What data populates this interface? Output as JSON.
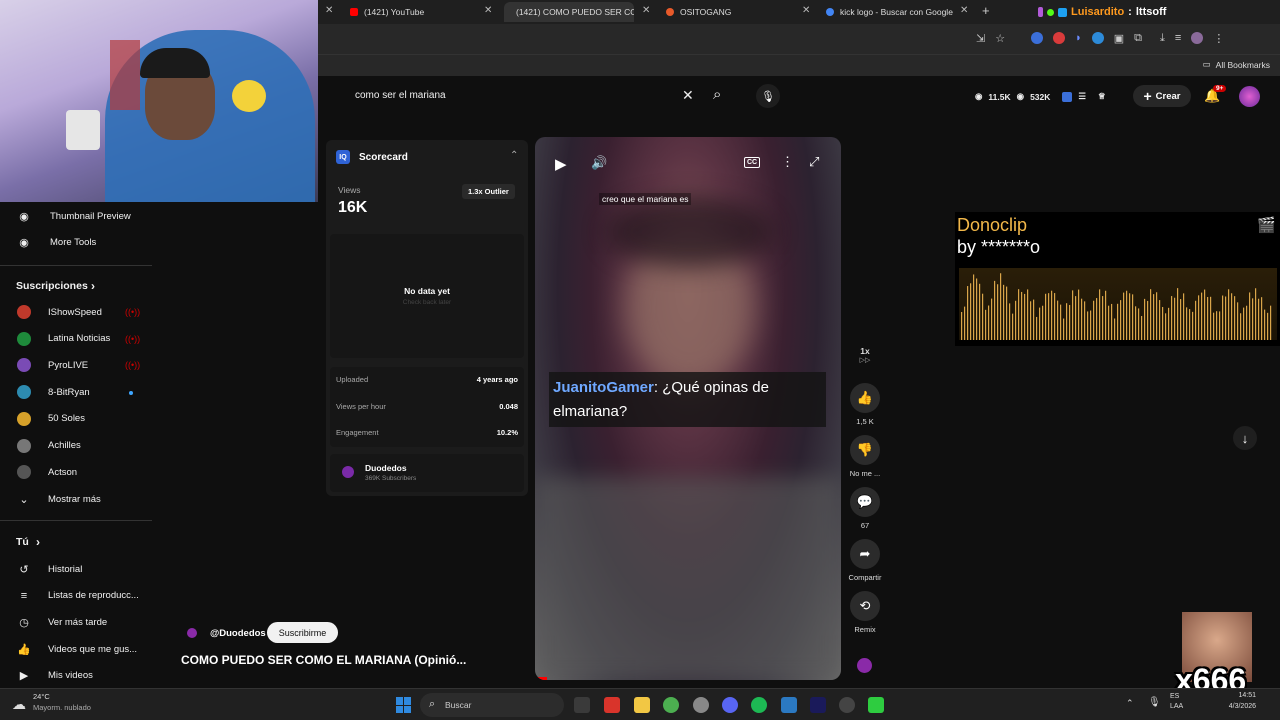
{
  "browser": {
    "tabs": [
      {
        "title": "(1421) YouTube",
        "color": "#ff0000"
      },
      {
        "title": "(1421) COMO PUEDO SER COM",
        "color": "#ff0000"
      },
      {
        "title": "OSITOGANG",
        "color": "#e85a2a"
      },
      {
        "title": "kick logo - Buscar con Google",
        "color": "#4285f4"
      }
    ],
    "new_tab": "+",
    "bookmarks_label": "All Bookmarks"
  },
  "stream_overlay": {
    "streamer": "Luisardito",
    "separator": ":",
    "status": "lttsoff"
  },
  "youtube": {
    "search_value": "como ser el mariana",
    "stats": {
      "views": "11.5K",
      "subs": "532K"
    },
    "create_label": "Crear",
    "notif_badge": "9+"
  },
  "sidebar": {
    "tools": [
      {
        "label": "Thumbnail Preview",
        "icon": "circle-dot-icon"
      },
      {
        "label": "More Tools",
        "icon": "circle-dot-icon"
      }
    ],
    "subs_title": "Suscripciones",
    "subs": [
      {
        "label": "IShowSpeed",
        "color": "#c0392b",
        "live": true
      },
      {
        "label": "Latina Noticias",
        "color": "#1e8a3b",
        "live": true
      },
      {
        "label": "PyroLIVE",
        "color": "#7a4bb5",
        "live": true
      },
      {
        "label": "8-BitRyan",
        "color": "#2d8bb0",
        "live": false
      },
      {
        "label": "50 Soles",
        "color": "#d6a12a",
        "live": false
      },
      {
        "label": "Achilles",
        "color": "#777777",
        "live": false
      },
      {
        "label": "Actson",
        "color": "#555555",
        "live": false
      }
    ],
    "show_more": "Mostrar más",
    "you_title": "Tú",
    "you_items": [
      {
        "label": "Historial",
        "icon": "history-icon",
        "glyph": "↺"
      },
      {
        "label": "Listas de reproducc...",
        "icon": "playlist-icon",
        "glyph": "≡"
      },
      {
        "label": "Ver más tarde",
        "icon": "clock-icon",
        "glyph": "◷"
      },
      {
        "label": "Videos que me gus...",
        "icon": "thumb-up-icon",
        "glyph": "👍"
      },
      {
        "label": "Mis videos",
        "icon": "my-videos-icon",
        "glyph": "▶"
      }
    ]
  },
  "scorecard": {
    "title": "Scorecard",
    "views_label": "Views",
    "views_value": "16K",
    "outlier": "1.3x Outlier",
    "no_data": "No data yet",
    "no_data_sub": "Check back later",
    "rows": [
      {
        "label": "Uploaded",
        "value": "4 years ago"
      },
      {
        "label": "Views per hour",
        "value": "0.048"
      },
      {
        "label": "Engagement",
        "value": "10.2%"
      }
    ],
    "channel_name": "Duodedos",
    "channel_subs": "369K Subscribers"
  },
  "short": {
    "caption": "creo que el mariana es",
    "comment_user": "JuanitoGamer",
    "comment_text": "¿Qué opinas de elmariana?",
    "channel_handle": "@Duodedos",
    "subscribe_label": "Suscribirme",
    "title": "COMO PUEDO SER COMO EL MARIANA (Opinió..."
  },
  "actions": {
    "speed": "1x",
    "likes": "1,5 K",
    "dislike": "No me ...",
    "comments": "67",
    "share": "Compartir",
    "remix": "Remix"
  },
  "donoclip": {
    "title": "Donoclip",
    "by": "by *******o"
  },
  "counter_overlay": "x666",
  "taskbar": {
    "weather_temp": "24°C",
    "weather_desc": "Mayorm. nublado",
    "search_placeholder": "Buscar",
    "lang": "ES\nLAA",
    "time": "14:51",
    "date": "4/3/2026"
  }
}
